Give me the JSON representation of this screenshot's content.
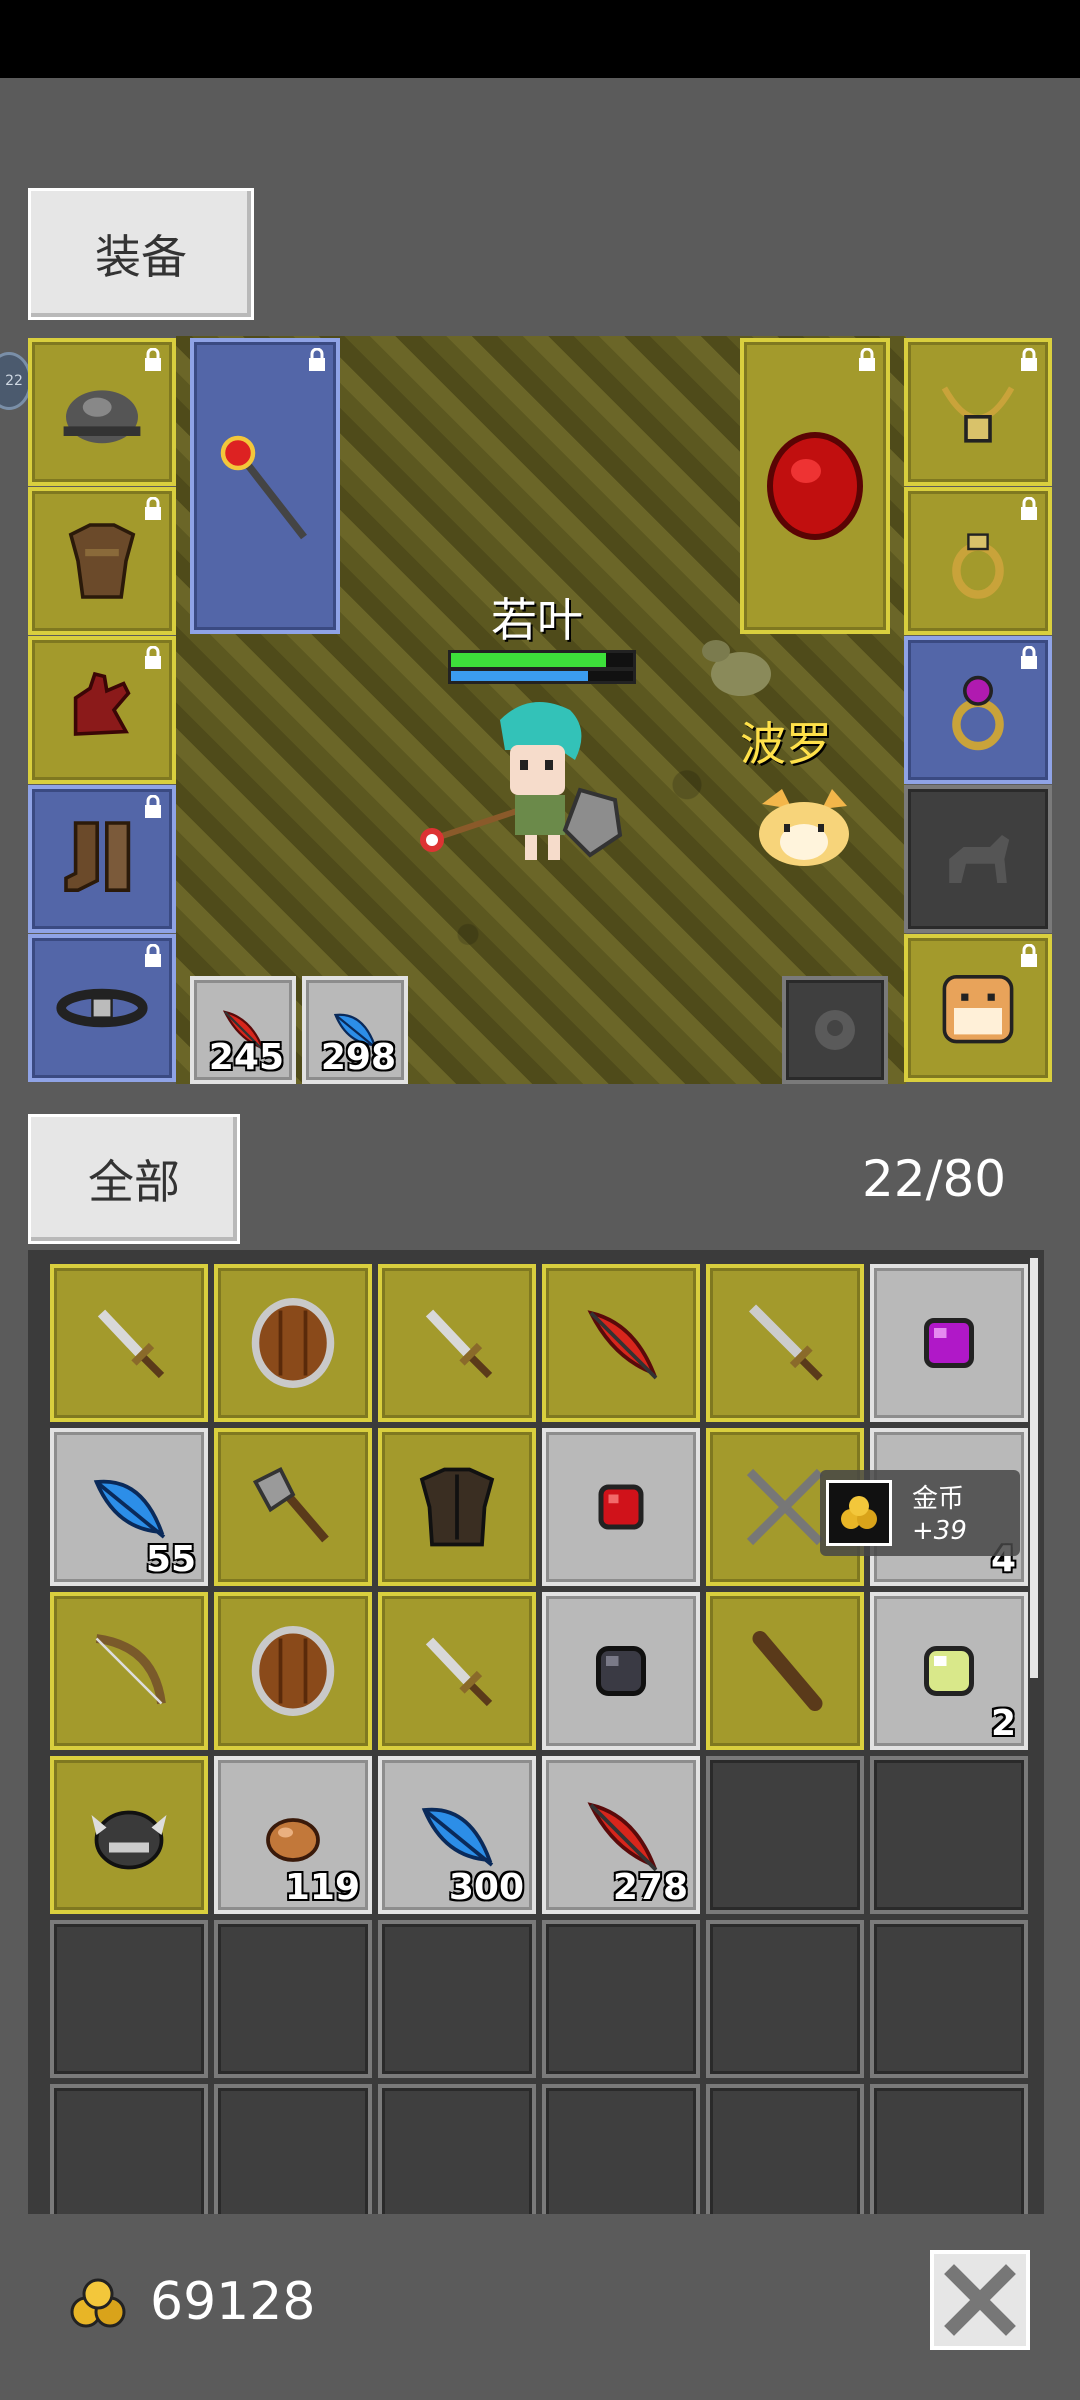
{
  "tabs": {
    "equip_label": "装备",
    "all_label": "全部"
  },
  "hero": {
    "name": "若叶",
    "hp_fraction": 0.85,
    "mp_fraction": 0.75
  },
  "pet": {
    "name": "波罗"
  },
  "quickbar": [
    {
      "icon": "red-feather-icon",
      "count": "245"
    },
    {
      "icon": "blue-feather-icon",
      "count": "298"
    }
  ],
  "equipment": {
    "left": [
      {
        "icon": "helmet-icon",
        "frame": "yellow",
        "locked": true
      },
      {
        "icon": "leather-armor-icon",
        "frame": "yellow",
        "locked": true
      },
      {
        "icon": "red-gloves-icon",
        "frame": "yellow",
        "locked": true
      },
      {
        "icon": "boots-icon",
        "frame": "blue",
        "locked": true
      },
      {
        "icon": "belt-icon",
        "frame": "blue",
        "locked": true
      }
    ],
    "weapon": {
      "icon": "ruby-staff-icon",
      "frame": "blue",
      "locked": true
    },
    "offhand": {
      "icon": "red-gem-shield-icon",
      "frame": "yellow",
      "locked": true
    },
    "right": [
      {
        "icon": "gold-necklace-icon",
        "frame": "yellow",
        "locked": true
      },
      {
        "icon": "gold-ring-icon",
        "frame": "yellow",
        "locked": true
      },
      {
        "icon": "amethyst-ring-icon",
        "frame": "blue",
        "locked": true
      },
      {
        "icon": "mount-silhouette-icon",
        "frame": "dark",
        "locked": false
      },
      {
        "icon": "pet-dog-icon",
        "frame": "yellow",
        "locked": true
      }
    ]
  },
  "inventory": {
    "capacity_text": "22/80",
    "cells": [
      {
        "icon": "dagger-icon",
        "frame": "yellow",
        "count": ""
      },
      {
        "icon": "round-shield-icon",
        "frame": "yellow",
        "count": ""
      },
      {
        "icon": "dagger-icon",
        "frame": "yellow",
        "count": ""
      },
      {
        "icon": "red-feather-icon",
        "frame": "yellow",
        "count": ""
      },
      {
        "icon": "sword-icon",
        "frame": "yellow",
        "count": ""
      },
      {
        "icon": "purple-gem-icon",
        "frame": "gray",
        "count": ""
      },
      {
        "icon": "blue-feather-icon",
        "frame": "gray",
        "count": "55"
      },
      {
        "icon": "axe-icon",
        "frame": "yellow",
        "count": ""
      },
      {
        "icon": "dark-armor-icon",
        "frame": "yellow",
        "count": ""
      },
      {
        "icon": "red-gem-icon",
        "frame": "gray",
        "count": ""
      },
      {
        "icon": "crossed-swords-icon",
        "frame": "yellow",
        "count": ""
      },
      {
        "icon": "item-icon",
        "frame": "gray",
        "count": "4"
      },
      {
        "icon": "bow-icon",
        "frame": "yellow",
        "count": ""
      },
      {
        "icon": "round-shield-icon",
        "frame": "yellow",
        "count": ""
      },
      {
        "icon": "dagger-icon",
        "frame": "yellow",
        "count": ""
      },
      {
        "icon": "black-gem-icon",
        "frame": "gray",
        "count": ""
      },
      {
        "icon": "club-icon",
        "frame": "yellow",
        "count": ""
      },
      {
        "icon": "green-gem-icon",
        "frame": "gray",
        "count": "2"
      },
      {
        "icon": "horned-helmet-icon",
        "frame": "yellow",
        "count": ""
      },
      {
        "icon": "ore-icon",
        "frame": "gray",
        "count": "119"
      },
      {
        "icon": "blue-feather-icon",
        "frame": "gray",
        "count": "300"
      },
      {
        "icon": "red-feather-icon",
        "frame": "gray",
        "count": "278"
      },
      {
        "icon": "",
        "frame": "dark",
        "count": ""
      },
      {
        "icon": "",
        "frame": "dark",
        "count": ""
      },
      {
        "icon": "",
        "frame": "dark",
        "count": ""
      },
      {
        "icon": "",
        "frame": "dark",
        "count": ""
      },
      {
        "icon": "",
        "frame": "dark",
        "count": ""
      },
      {
        "icon": "",
        "frame": "dark",
        "count": ""
      },
      {
        "icon": "",
        "frame": "dark",
        "count": ""
      },
      {
        "icon": "",
        "frame": "dark",
        "count": ""
      },
      {
        "icon": "",
        "frame": "dark",
        "count": ""
      },
      {
        "icon": "",
        "frame": "dark",
        "count": ""
      },
      {
        "icon": "",
        "frame": "dark",
        "count": ""
      },
      {
        "icon": "",
        "frame": "dark",
        "count": ""
      },
      {
        "icon": "",
        "frame": "dark",
        "count": ""
      },
      {
        "icon": "",
        "frame": "dark",
        "count": ""
      }
    ]
  },
  "gold_toast": {
    "label": "金币",
    "amount": "+39"
  },
  "footer": {
    "gold": "69128"
  },
  "side_badge": "22"
}
